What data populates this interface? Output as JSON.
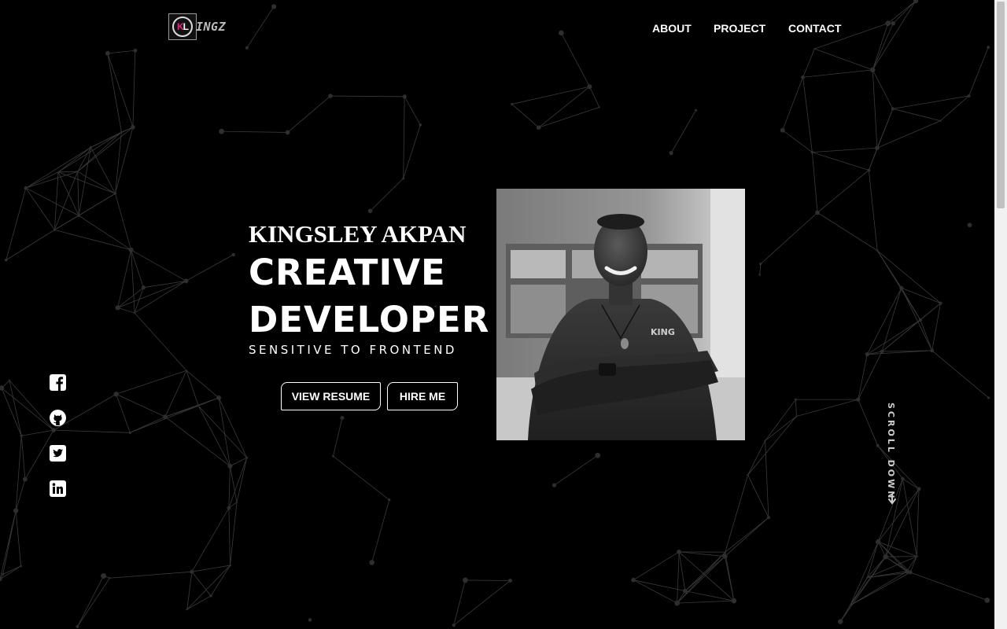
{
  "header": {
    "logo": {
      "mark": "K",
      "mark_rest": "L",
      "text": "INGZ"
    },
    "nav": [
      "ABOUT",
      "PROJECT",
      "CONTACT"
    ]
  },
  "hero": {
    "name": "KINGSLEY AKPAN",
    "title_line1": "CREATIVE",
    "title_line2": "DEVELOPER",
    "subtitle": "SENSITIVE TO FRONTEND",
    "buttons": {
      "resume": "VIEW RESUME",
      "hire": "HIRE ME"
    }
  },
  "social": [
    "facebook-icon",
    "github-icon",
    "twitter-icon",
    "linkedin-icon"
  ],
  "scroll_down": "SCROLL DOWN",
  "colors": {
    "background": "#000000",
    "text": "#ffffff",
    "logo_accent": "#e6247d",
    "network_lines": "#3a3a3a"
  }
}
